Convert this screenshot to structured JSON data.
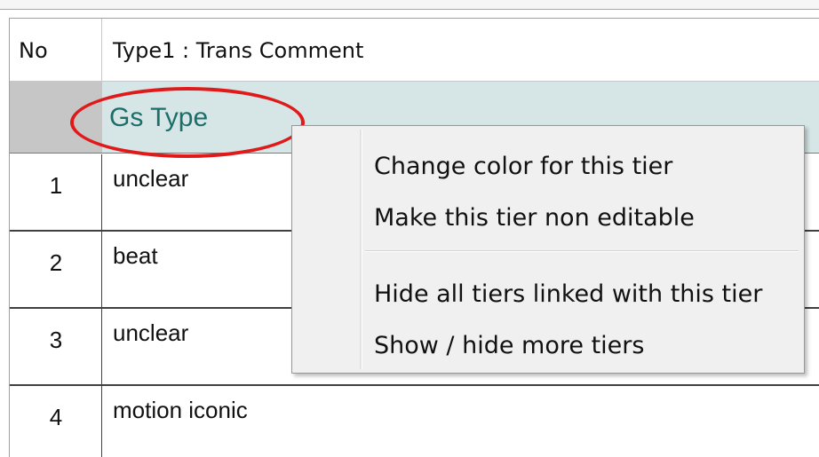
{
  "grid": {
    "columns": {
      "no_header": "No",
      "type_header": "Type1 : Trans Comment"
    },
    "tier": {
      "label": "Gs Type"
    },
    "rows": [
      {
        "no": "1",
        "text": "unclear"
      },
      {
        "no": "2",
        "text": "beat"
      },
      {
        "no": "3",
        "text": "unclear"
      },
      {
        "no": "4",
        "text": "motion iconic"
      }
    ]
  },
  "context_menu": {
    "items": [
      {
        "label": "Change color for this tier"
      },
      {
        "label": "Make this tier non editable"
      },
      {
        "label": "Hide all tiers linked with this tier"
      },
      {
        "label": "Show / hide more tiers"
      }
    ]
  },
  "colors": {
    "tier_row_bg": "#d6e6e6",
    "tier_label": "#1a6f6a",
    "highlight_ellipse": "#e01a1a",
    "menu_bg": "#f0f0f0"
  }
}
